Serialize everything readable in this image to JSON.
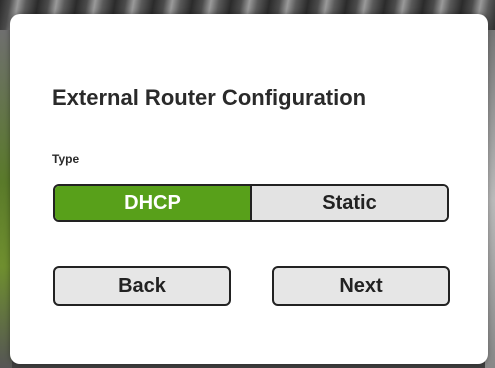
{
  "dialog": {
    "title": "External Router Configuration",
    "type_label": "Type",
    "type_options": [
      {
        "label": "DHCP",
        "selected": true
      },
      {
        "label": "Static",
        "selected": false
      }
    ],
    "back_label": "Back",
    "next_label": "Next"
  },
  "colors": {
    "accent": "#58a01a",
    "button_bg": "#e6e6e6",
    "border": "#222222",
    "dialog_bg": "#ffffff"
  }
}
